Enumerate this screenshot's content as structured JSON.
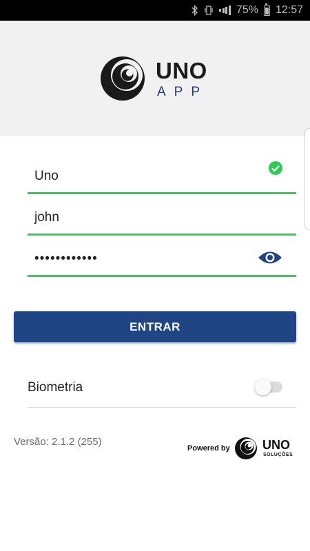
{
  "status_bar": {
    "battery": "75%",
    "time": "12:57",
    "icons": [
      "bluetooth-icon",
      "vibrate-icon",
      "signal-icon",
      "battery-icon"
    ]
  },
  "header": {
    "logo_word": "UNO",
    "logo_sub": "APP",
    "logo_color": "#1e3a7a"
  },
  "form": {
    "company_value": "Uno",
    "username_value": "john",
    "password_value": "••••••••••••",
    "valid_color": "#2ecc57"
  },
  "login_button": {
    "label": "ENTRAR",
    "color": "#1f4584"
  },
  "biometrics": {
    "label": "Biometria",
    "enabled": false
  },
  "footer": {
    "version": "Versão: 2.1.2 (255)",
    "powered_by": "Powered by",
    "brand": "UNO",
    "brand_sub": "SOLUÇÕES"
  }
}
